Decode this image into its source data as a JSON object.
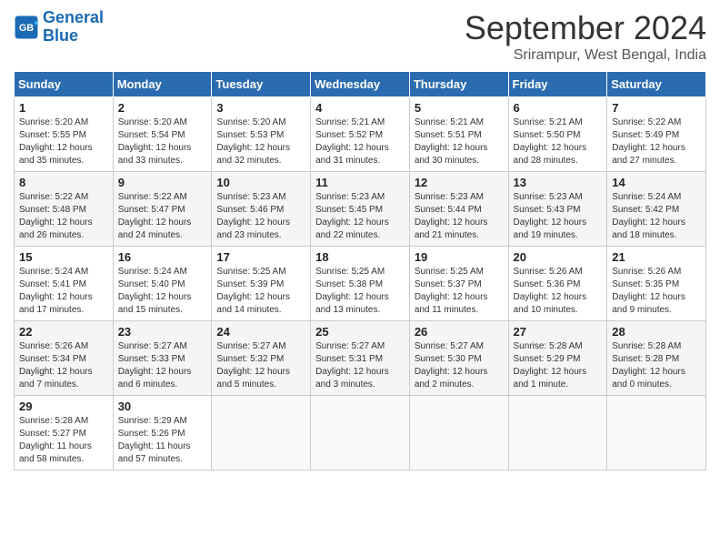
{
  "header": {
    "logo_line1": "General",
    "logo_line2": "Blue",
    "month_title": "September 2024",
    "subtitle": "Srirampur, West Bengal, India"
  },
  "days_of_week": [
    "Sunday",
    "Monday",
    "Tuesday",
    "Wednesday",
    "Thursday",
    "Friday",
    "Saturday"
  ],
  "weeks": [
    [
      {
        "day": "1",
        "info": "Sunrise: 5:20 AM\nSunset: 5:55 PM\nDaylight: 12 hours\nand 35 minutes."
      },
      {
        "day": "2",
        "info": "Sunrise: 5:20 AM\nSunset: 5:54 PM\nDaylight: 12 hours\nand 33 minutes."
      },
      {
        "day": "3",
        "info": "Sunrise: 5:20 AM\nSunset: 5:53 PM\nDaylight: 12 hours\nand 32 minutes."
      },
      {
        "day": "4",
        "info": "Sunrise: 5:21 AM\nSunset: 5:52 PM\nDaylight: 12 hours\nand 31 minutes."
      },
      {
        "day": "5",
        "info": "Sunrise: 5:21 AM\nSunset: 5:51 PM\nDaylight: 12 hours\nand 30 minutes."
      },
      {
        "day": "6",
        "info": "Sunrise: 5:21 AM\nSunset: 5:50 PM\nDaylight: 12 hours\nand 28 minutes."
      },
      {
        "day": "7",
        "info": "Sunrise: 5:22 AM\nSunset: 5:49 PM\nDaylight: 12 hours\nand 27 minutes."
      }
    ],
    [
      {
        "day": "8",
        "info": "Sunrise: 5:22 AM\nSunset: 5:48 PM\nDaylight: 12 hours\nand 26 minutes."
      },
      {
        "day": "9",
        "info": "Sunrise: 5:22 AM\nSunset: 5:47 PM\nDaylight: 12 hours\nand 24 minutes."
      },
      {
        "day": "10",
        "info": "Sunrise: 5:23 AM\nSunset: 5:46 PM\nDaylight: 12 hours\nand 23 minutes."
      },
      {
        "day": "11",
        "info": "Sunrise: 5:23 AM\nSunset: 5:45 PM\nDaylight: 12 hours\nand 22 minutes."
      },
      {
        "day": "12",
        "info": "Sunrise: 5:23 AM\nSunset: 5:44 PM\nDaylight: 12 hours\nand 21 minutes."
      },
      {
        "day": "13",
        "info": "Sunrise: 5:23 AM\nSunset: 5:43 PM\nDaylight: 12 hours\nand 19 minutes."
      },
      {
        "day": "14",
        "info": "Sunrise: 5:24 AM\nSunset: 5:42 PM\nDaylight: 12 hours\nand 18 minutes."
      }
    ],
    [
      {
        "day": "15",
        "info": "Sunrise: 5:24 AM\nSunset: 5:41 PM\nDaylight: 12 hours\nand 17 minutes."
      },
      {
        "day": "16",
        "info": "Sunrise: 5:24 AM\nSunset: 5:40 PM\nDaylight: 12 hours\nand 15 minutes."
      },
      {
        "day": "17",
        "info": "Sunrise: 5:25 AM\nSunset: 5:39 PM\nDaylight: 12 hours\nand 14 minutes."
      },
      {
        "day": "18",
        "info": "Sunrise: 5:25 AM\nSunset: 5:38 PM\nDaylight: 12 hours\nand 13 minutes."
      },
      {
        "day": "19",
        "info": "Sunrise: 5:25 AM\nSunset: 5:37 PM\nDaylight: 12 hours\nand 11 minutes."
      },
      {
        "day": "20",
        "info": "Sunrise: 5:26 AM\nSunset: 5:36 PM\nDaylight: 12 hours\nand 10 minutes."
      },
      {
        "day": "21",
        "info": "Sunrise: 5:26 AM\nSunset: 5:35 PM\nDaylight: 12 hours\nand 9 minutes."
      }
    ],
    [
      {
        "day": "22",
        "info": "Sunrise: 5:26 AM\nSunset: 5:34 PM\nDaylight: 12 hours\nand 7 minutes."
      },
      {
        "day": "23",
        "info": "Sunrise: 5:27 AM\nSunset: 5:33 PM\nDaylight: 12 hours\nand 6 minutes."
      },
      {
        "day": "24",
        "info": "Sunrise: 5:27 AM\nSunset: 5:32 PM\nDaylight: 12 hours\nand 5 minutes."
      },
      {
        "day": "25",
        "info": "Sunrise: 5:27 AM\nSunset: 5:31 PM\nDaylight: 12 hours\nand 3 minutes."
      },
      {
        "day": "26",
        "info": "Sunrise: 5:27 AM\nSunset: 5:30 PM\nDaylight: 12 hours\nand 2 minutes."
      },
      {
        "day": "27",
        "info": "Sunrise: 5:28 AM\nSunset: 5:29 PM\nDaylight: 12 hours\nand 1 minute."
      },
      {
        "day": "28",
        "info": "Sunrise: 5:28 AM\nSunset: 5:28 PM\nDaylight: 12 hours\nand 0 minutes."
      }
    ],
    [
      {
        "day": "29",
        "info": "Sunrise: 5:28 AM\nSunset: 5:27 PM\nDaylight: 11 hours\nand 58 minutes."
      },
      {
        "day": "30",
        "info": "Sunrise: 5:29 AM\nSunset: 5:26 PM\nDaylight: 11 hours\nand 57 minutes."
      },
      {
        "day": "",
        "info": ""
      },
      {
        "day": "",
        "info": ""
      },
      {
        "day": "",
        "info": ""
      },
      {
        "day": "",
        "info": ""
      },
      {
        "day": "",
        "info": ""
      }
    ]
  ]
}
